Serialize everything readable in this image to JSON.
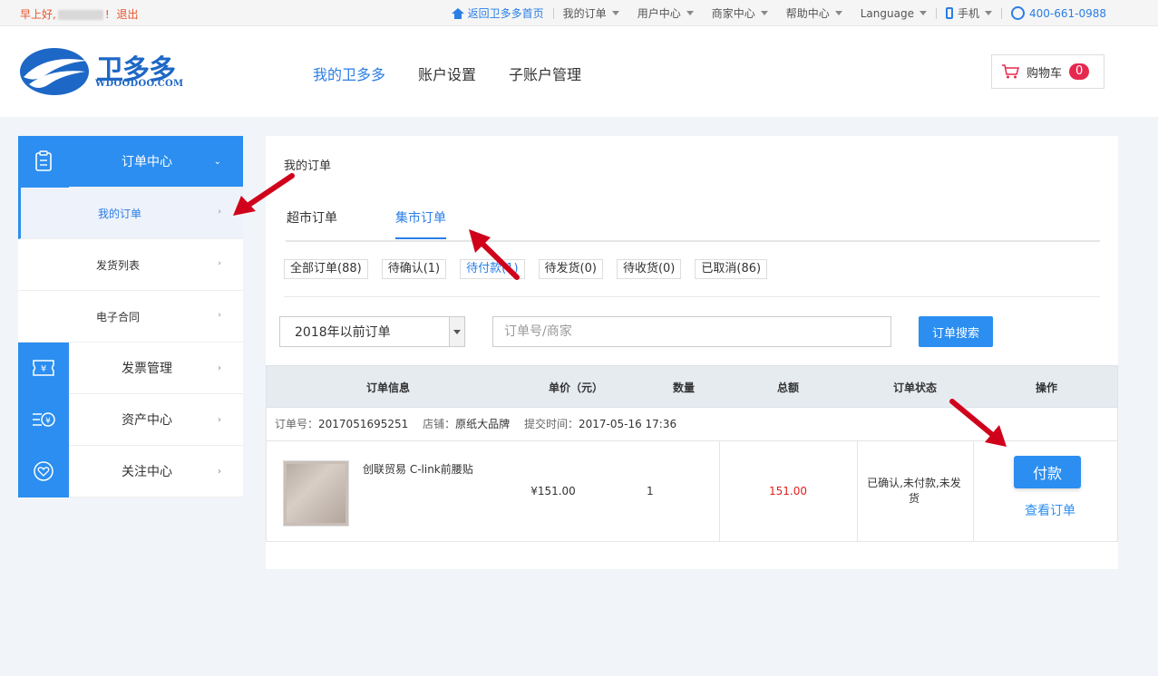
{
  "topbar": {
    "greeting_prefix": "早上好,",
    "greeting_suffix": "!",
    "logout": "退出",
    "home_link": "返回卫多多首页",
    "my_orders": "我的订单",
    "user_center": "用户中心",
    "merchant_center": "商家中心",
    "help_center": "帮助中心",
    "language": "Language",
    "mobile": "手机",
    "phone": "400-661-0988"
  },
  "header": {
    "logo_cn": "卫多多",
    "logo_en": "WDOODOO.COM",
    "nav": [
      "我的卫多多",
      "账户设置",
      "子账户管理"
    ],
    "cart_label": "购物车",
    "cart_count": "0"
  },
  "sidebar": {
    "order_center": "订单中心",
    "my_orders": "我的订单",
    "shipping_list": "发货列表",
    "e_contract": "电子合同",
    "invoice_mgmt": "发票管理",
    "asset_center": "资产中心",
    "follow_center": "关注中心"
  },
  "main": {
    "title": "我的订单",
    "tabs": [
      "超市订单",
      "集市订单"
    ],
    "filters": [
      "全部订单(88)",
      "待确认(1)",
      "待付款(1)",
      "待发货(0)",
      "待收货(0)",
      "已取消(86)"
    ],
    "period_select": "2018年以前订单",
    "search_placeholder": "订单号/商家",
    "search_button": "订单搜索",
    "columns": [
      "订单信息",
      "单价（元）",
      "数量",
      "总额",
      "订单状态",
      "操作"
    ],
    "order": {
      "order_no_label": "订单号：",
      "order_no": "2017051695251",
      "store_label": "店铺：",
      "store": "原纸大品牌",
      "time_label": "提交时间：",
      "time": "2017-05-16 17:36",
      "product_name": "创联贸易 C-link前腰贴",
      "unit_price": "¥151.00",
      "quantity": "1",
      "total": "151.00",
      "status": "已确认,未付款,未发货",
      "pay_button": "付款",
      "view_link": "查看订单"
    }
  },
  "colors": {
    "accent": "#2b8ef0",
    "price_red": "#e02020",
    "annotation_arrow": "#d0021b"
  }
}
